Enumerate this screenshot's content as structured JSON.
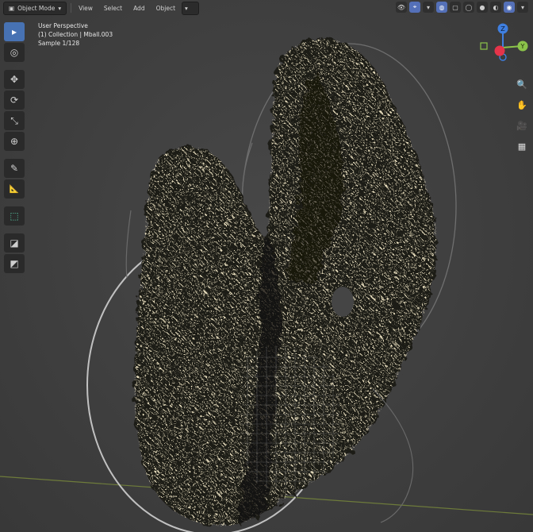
{
  "header": {
    "mode": "Object Mode",
    "menus": [
      "View",
      "Select",
      "Add",
      "Object"
    ]
  },
  "overlay": {
    "view_name": "User Perspective",
    "collection": "(1) Collection | Mball.003",
    "sample": "Sample 1/128"
  },
  "toolbar": {
    "tools": [
      {
        "name": "select-box-tool",
        "glyph": "▸",
        "active": true
      },
      {
        "name": "cursor-tool",
        "glyph": "◎"
      },
      {
        "name": "move-tool",
        "glyph": "✥"
      },
      {
        "name": "rotate-tool",
        "glyph": "⟳"
      },
      {
        "name": "scale-tool",
        "glyph": "⤡"
      },
      {
        "name": "transform-tool",
        "glyph": "⊕"
      },
      {
        "name": "annotate-tool",
        "glyph": "✎"
      },
      {
        "name": "measure-tool",
        "glyph": "📐"
      },
      {
        "name": "add-cube-tool",
        "glyph": "⬚"
      },
      {
        "name": "extra-tool-1",
        "glyph": "◪"
      },
      {
        "name": "extra-tool-2",
        "glyph": "◩"
      }
    ]
  },
  "gizmo": {
    "z_label": "Z",
    "y_label": "Y",
    "x_color": "#e5344a",
    "y_color": "#8bc34a",
    "z_color": "#3f7fe0"
  },
  "nav_icons": [
    "zoom-icon",
    "hand-icon",
    "camera-icon",
    "grid-icon"
  ]
}
